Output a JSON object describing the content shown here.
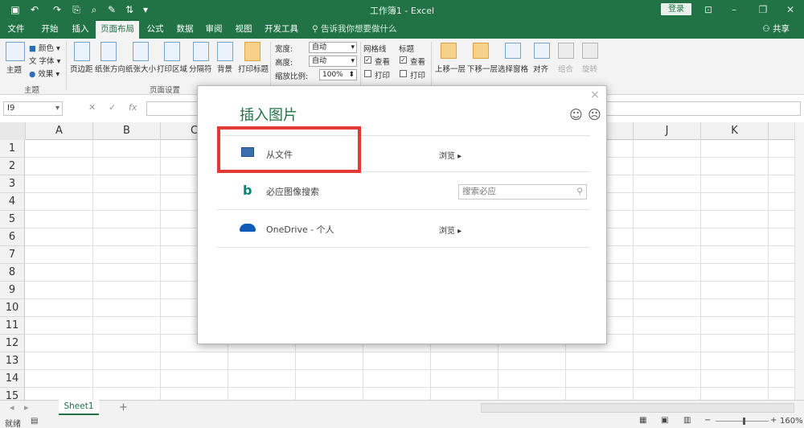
{
  "app": {
    "title": "工作簿1 - Excel",
    "login_label": "登录",
    "share_label": "共享",
    "tell_me": "告诉我你想要做什么"
  },
  "tabs": [
    {
      "label": "文件",
      "active": false
    },
    {
      "label": "开始",
      "active": false
    },
    {
      "label": "插入",
      "active": false
    },
    {
      "label": "页面布局",
      "active": true
    },
    {
      "label": "公式",
      "active": false
    },
    {
      "label": "数据",
      "active": false
    },
    {
      "label": "审阅",
      "active": false
    },
    {
      "label": "视图",
      "active": false
    },
    {
      "label": "开发工具",
      "active": false
    }
  ],
  "ribbon": {
    "theme_group": {
      "themes": "主题",
      "colors": "颜色",
      "fonts": "字体",
      "effects": "效果",
      "label": "主题"
    },
    "page_setup": {
      "margins": "页边距",
      "orientation": "纸张方向",
      "size": "纸张大小",
      "print_area": "打印区域",
      "breaks": "分隔符",
      "background": "背景",
      "print_titles": "打印标题",
      "label": "页面设置"
    },
    "scale": {
      "width_label": "宽度:",
      "width_value": "自动",
      "height_label": "高度:",
      "height_value": "自动",
      "scale_label": "缩放比例:",
      "scale_value": "100%"
    },
    "sheet_options": {
      "gridlines": "网格线",
      "headings": "标题",
      "view": "查看",
      "print": "打印"
    },
    "arrange": {
      "bring_forward": "上移一层",
      "send_backward": "下移一层",
      "selection_pane": "选择窗格",
      "align": "对齐",
      "group": "组合",
      "rotate": "旋转"
    }
  },
  "formula_bar": {
    "name_box": "I9",
    "fx": "fx"
  },
  "grid": {
    "columns": [
      "A",
      "B",
      "C",
      "D",
      "E",
      "F",
      "G",
      "H",
      "I",
      "J",
      "K"
    ],
    "rows": [
      "1",
      "2",
      "3",
      "4",
      "5",
      "6",
      "7",
      "8",
      "9",
      "10",
      "11",
      "12",
      "13",
      "14",
      "15"
    ]
  },
  "sheets": {
    "tabs": [
      "Sheet1"
    ],
    "add": "+"
  },
  "status": {
    "ready": "就绪",
    "zoom": "160%"
  },
  "dialog": {
    "title": "插入图片",
    "close": "×",
    "rows": [
      {
        "label": "从文件",
        "action": "浏览 ▸",
        "icon": "computer-icon"
      },
      {
        "label": "必应图像搜索",
        "search_placeholder": "搜索必应",
        "icon": "bing-icon"
      },
      {
        "label": "OneDrive - 个人",
        "action": "浏览 ▸",
        "icon": "onedrive-icon"
      }
    ]
  },
  "colors": {
    "excel_green": "#217346",
    "highlight": "#e53935"
  }
}
